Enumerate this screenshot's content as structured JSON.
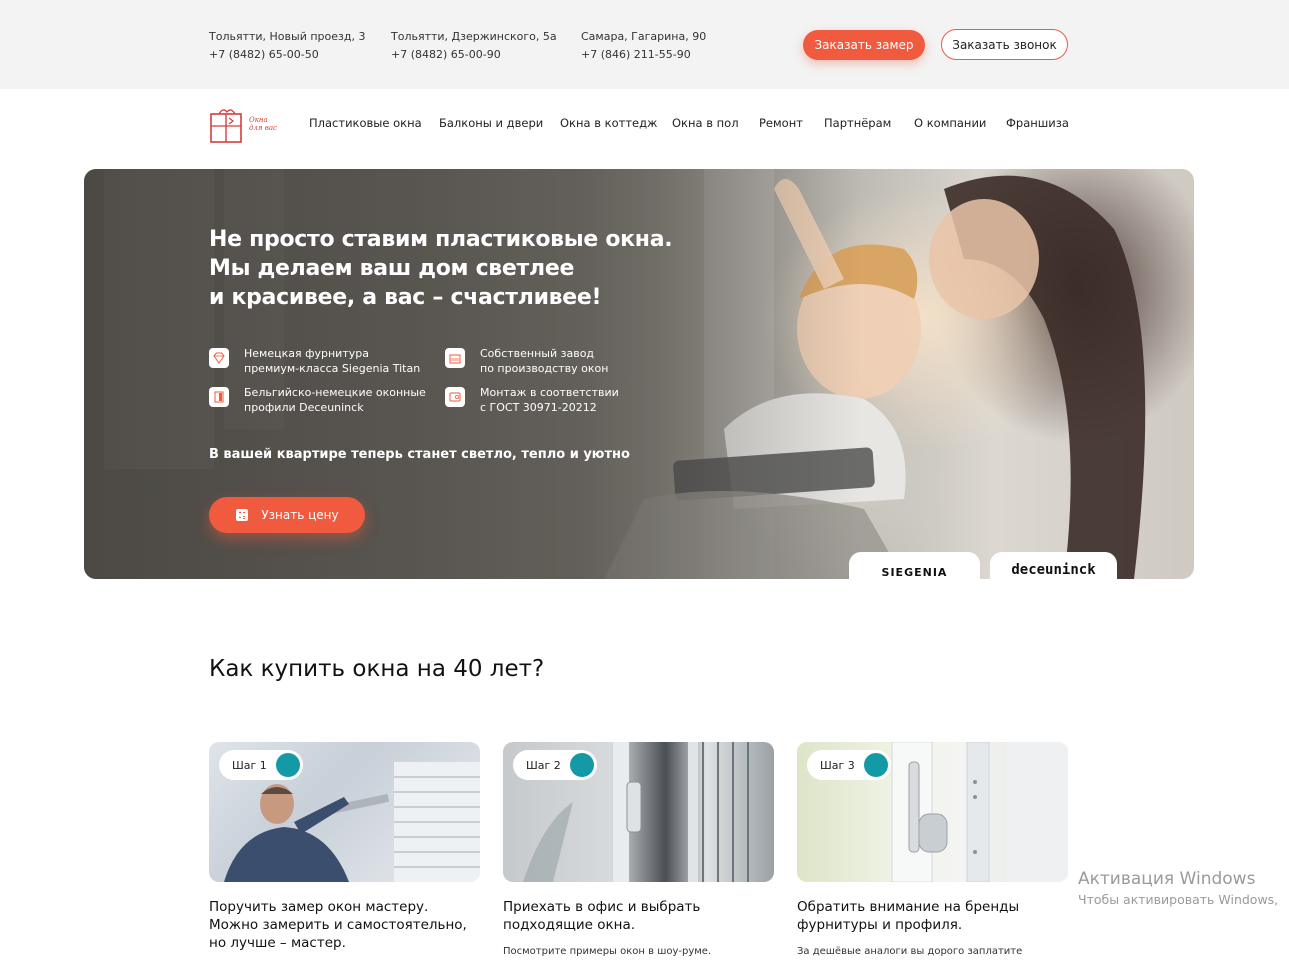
{
  "header": {
    "addresses": [
      {
        "city": "Тольятти, Новый проезд, 3",
        "phone": "+7 (8482) 65-00-50"
      },
      {
        "city": "Тольятти, Дзержинского, 5а",
        "phone": "+7 (8482) 65-00-90"
      },
      {
        "city": "Самара, Гагарина, 90",
        "phone": "+7 (846) 211-55-90"
      }
    ],
    "order_measure_label": "Заказать замер",
    "order_call_label": "Заказать звонок"
  },
  "logo": {
    "line1": "Окна",
    "line2": "для вас"
  },
  "nav": {
    "items": [
      {
        "label": "Пластиковые окна"
      },
      {
        "label": "Балконы и двери"
      },
      {
        "label": "Окна в коттедж"
      },
      {
        "label": "Окна в пол"
      },
      {
        "label": "Ремонт"
      },
      {
        "label": "Партнёрам"
      },
      {
        "label": "О компании"
      },
      {
        "label": "Франшиза"
      }
    ]
  },
  "hero": {
    "title_lines": [
      "Не просто ставим пластиковые окна.",
      "Мы делаем ваш дом светлее",
      "и красивее, а вас – счастливее!"
    ],
    "features": [
      {
        "icon": "diamond-icon",
        "line1": "Немецкая фурнитура",
        "line2": "премиум-класса Siegenia Titan"
      },
      {
        "icon": "factory-icon",
        "line1": "Собственный завод",
        "line2": "по производству окон"
      },
      {
        "icon": "window-profile-icon",
        "line1": "Бельгийско-немецкие оконные",
        "line2": "профили Deceuninck"
      },
      {
        "icon": "certificate-icon",
        "line1": "Монтаж в соответствии",
        "line2": "с ГОСТ 30971-20212"
      }
    ],
    "subtitle": "В вашей квартире теперь станет светло, тепло и уютно",
    "cta_label": "Узнать цену",
    "brands": [
      "SIEGENIA",
      "deceuninck"
    ]
  },
  "section": {
    "title": "Как купить окна на 40 лет?",
    "cards": [
      {
        "step": "Шаг 1",
        "text": "Поручить замер окон мастеру. Можно замерить и самостоятельно, но лучше – мастер.",
        "sub": ""
      },
      {
        "step": "Шаг 2",
        "text": "Приехать в офис и выбрать подходящие окна.",
        "sub": "Посмотрите примеры окон в шоу-руме."
      },
      {
        "step": "Шаг 3",
        "text": "Обратить внимание на бренды фурнитуры и профиля.",
        "sub": "За дешёвые аналоги вы дорого заплатите"
      }
    ]
  },
  "watermark": {
    "line1": "Активация Windows",
    "line2": "Чтобы активировать Windows,"
  },
  "colors": {
    "accent": "#f05a3f",
    "step_dot": "#149aa7",
    "topbar_bg": "#f3f3f3"
  }
}
